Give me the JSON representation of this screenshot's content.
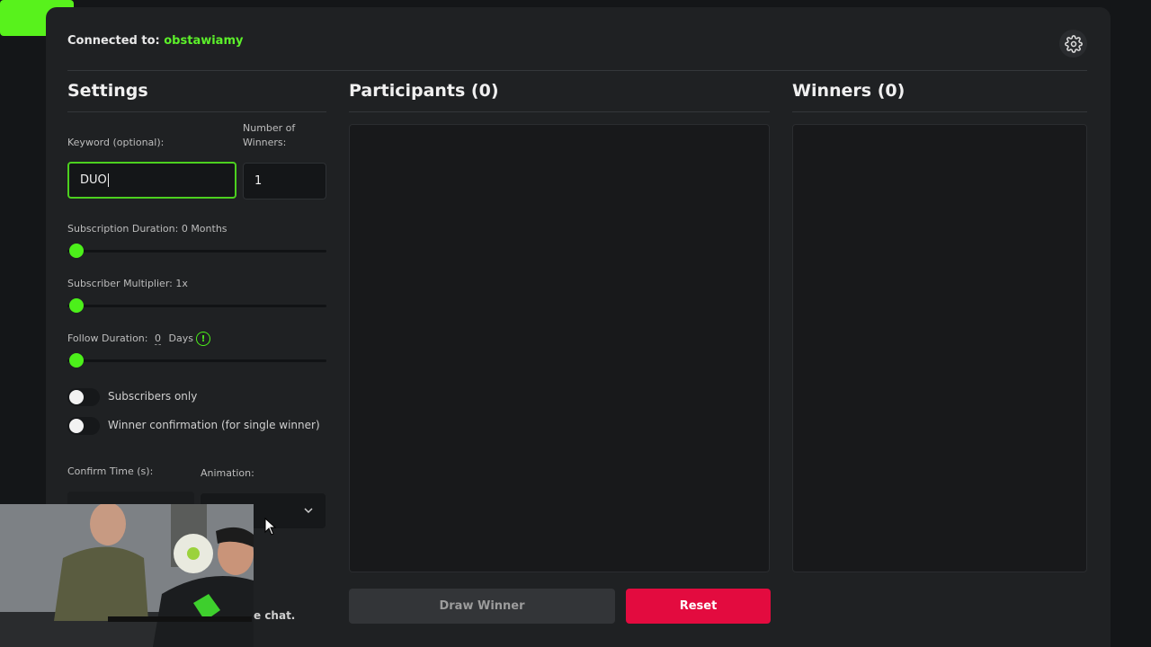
{
  "header": {
    "connected_label": "Connected to:",
    "channel_name": "obstawiamy",
    "settings_icon": "gear-icon"
  },
  "settings": {
    "title": "Settings",
    "keyword_label": "Keyword (optional):",
    "keyword_value": "DUO",
    "winners_label_line1": "Number of",
    "winners_label_line2": "Winners:",
    "winners_value": "1",
    "sub_duration_label": "Subscription Duration: 0 Months",
    "sub_multiplier_label": "Subscriber Multiplier: 1x",
    "follow_duration_label": "Follow Duration:",
    "follow_duration_value": "0",
    "follow_duration_unit": "Days",
    "info_icon": "info-icon",
    "subscribers_only_label": "Subscribers only",
    "winner_confirmation_label": "Winner confirmation (for single winner)",
    "confirm_time_label": "Confirm Time (s):",
    "animation_label": "Animation:",
    "chat_note_fragment": "e chat."
  },
  "sliders": {
    "subscription_duration": 0,
    "subscriber_multiplier": 0,
    "follow_duration": 0
  },
  "toggles": {
    "subscribers_only": false,
    "winner_confirmation": false
  },
  "participants": {
    "title": "Participants (0)"
  },
  "winners": {
    "title": "Winners (0)"
  },
  "actions": {
    "draw_label": "Draw Winner",
    "reset_label": "Reset"
  },
  "colors": {
    "accent": "#5cf02a",
    "danger": "#e30b3f",
    "background": "#141618",
    "panel": "#1f2123"
  }
}
